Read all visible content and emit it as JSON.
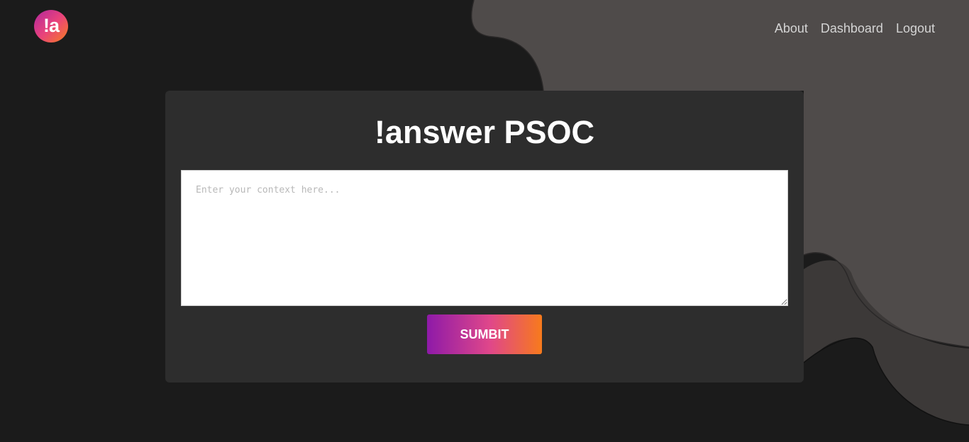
{
  "header": {
    "logo_text": "!a",
    "nav": [
      {
        "label": "About"
      },
      {
        "label": "Dashboard"
      },
      {
        "label": "Logout"
      }
    ]
  },
  "main": {
    "title": "!answer PSOC",
    "context_placeholder": "Enter your context here...",
    "context_value": "",
    "submit_label": "SUMBIT"
  },
  "colors": {
    "background": "#1b1b1b",
    "card": "#2d2d2d",
    "accent_gradient_start": "#8e1aa8",
    "accent_gradient_mid": "#e0478a",
    "accent_gradient_end": "#f77a1c"
  }
}
